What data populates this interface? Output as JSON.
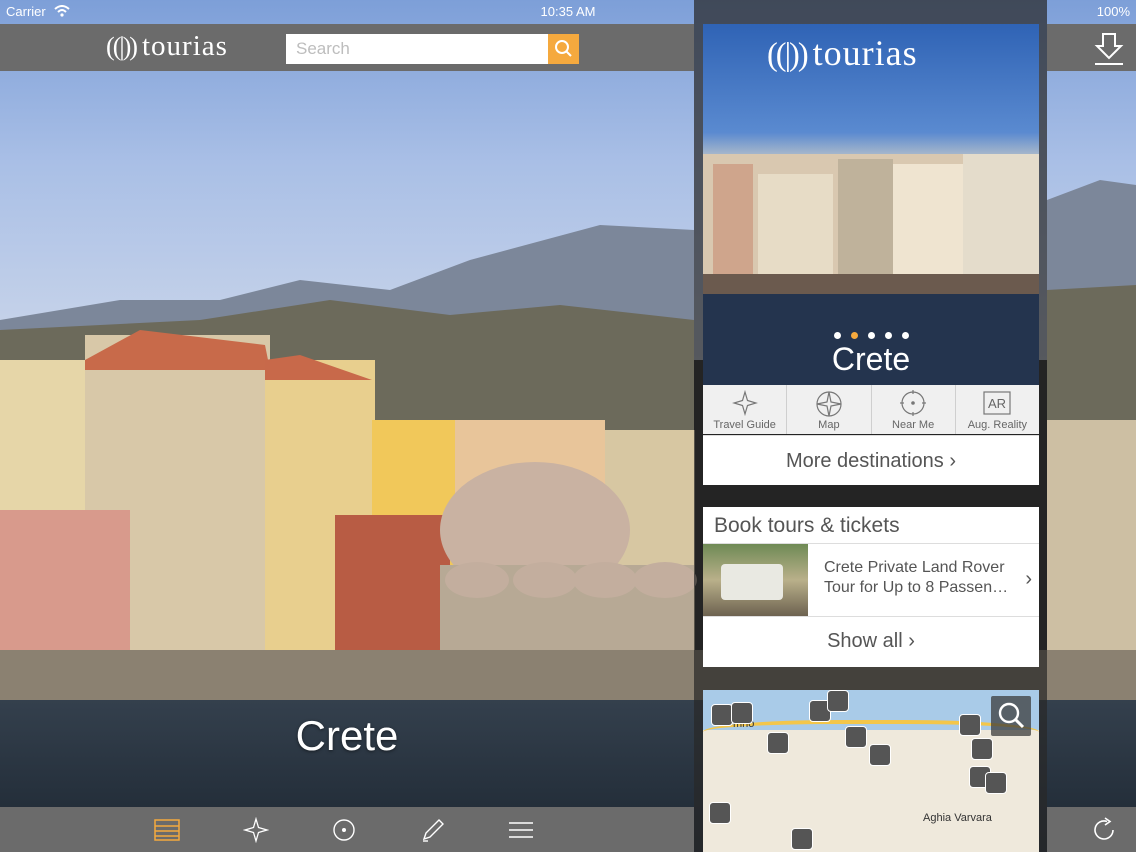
{
  "status": {
    "carrier": "Carrier",
    "time": "10:35 AM",
    "battery": "100%"
  },
  "header": {
    "logo": "tourias",
    "search_placeholder": "Search"
  },
  "destination": {
    "title": "Crete"
  },
  "panel": {
    "logo": "tourias",
    "hero_title": "Crete",
    "slides": {
      "count": 5,
      "active": 2
    },
    "features": [
      {
        "label": "Travel Guide",
        "icon": "star-icon"
      },
      {
        "label": "Map",
        "icon": "compass-icon"
      },
      {
        "label": "Near Me",
        "icon": "target-icon"
      },
      {
        "label": "Aug. Reality",
        "icon": "ar-icon",
        "icon_text": "AR"
      }
    ],
    "more_destinations": "More destinations",
    "tours": {
      "title": "Book tours & tickets",
      "item_line1": "Crete Private Land Rover",
      "item_line2": "Tour for Up to 8 Passen…",
      "show_all": "Show all"
    },
    "map": {
      "label_1": "mno",
      "label_2": "Aghia Varvara"
    }
  },
  "colors": {
    "accent": "#f5a93e",
    "bar": "#6b6b6b"
  }
}
